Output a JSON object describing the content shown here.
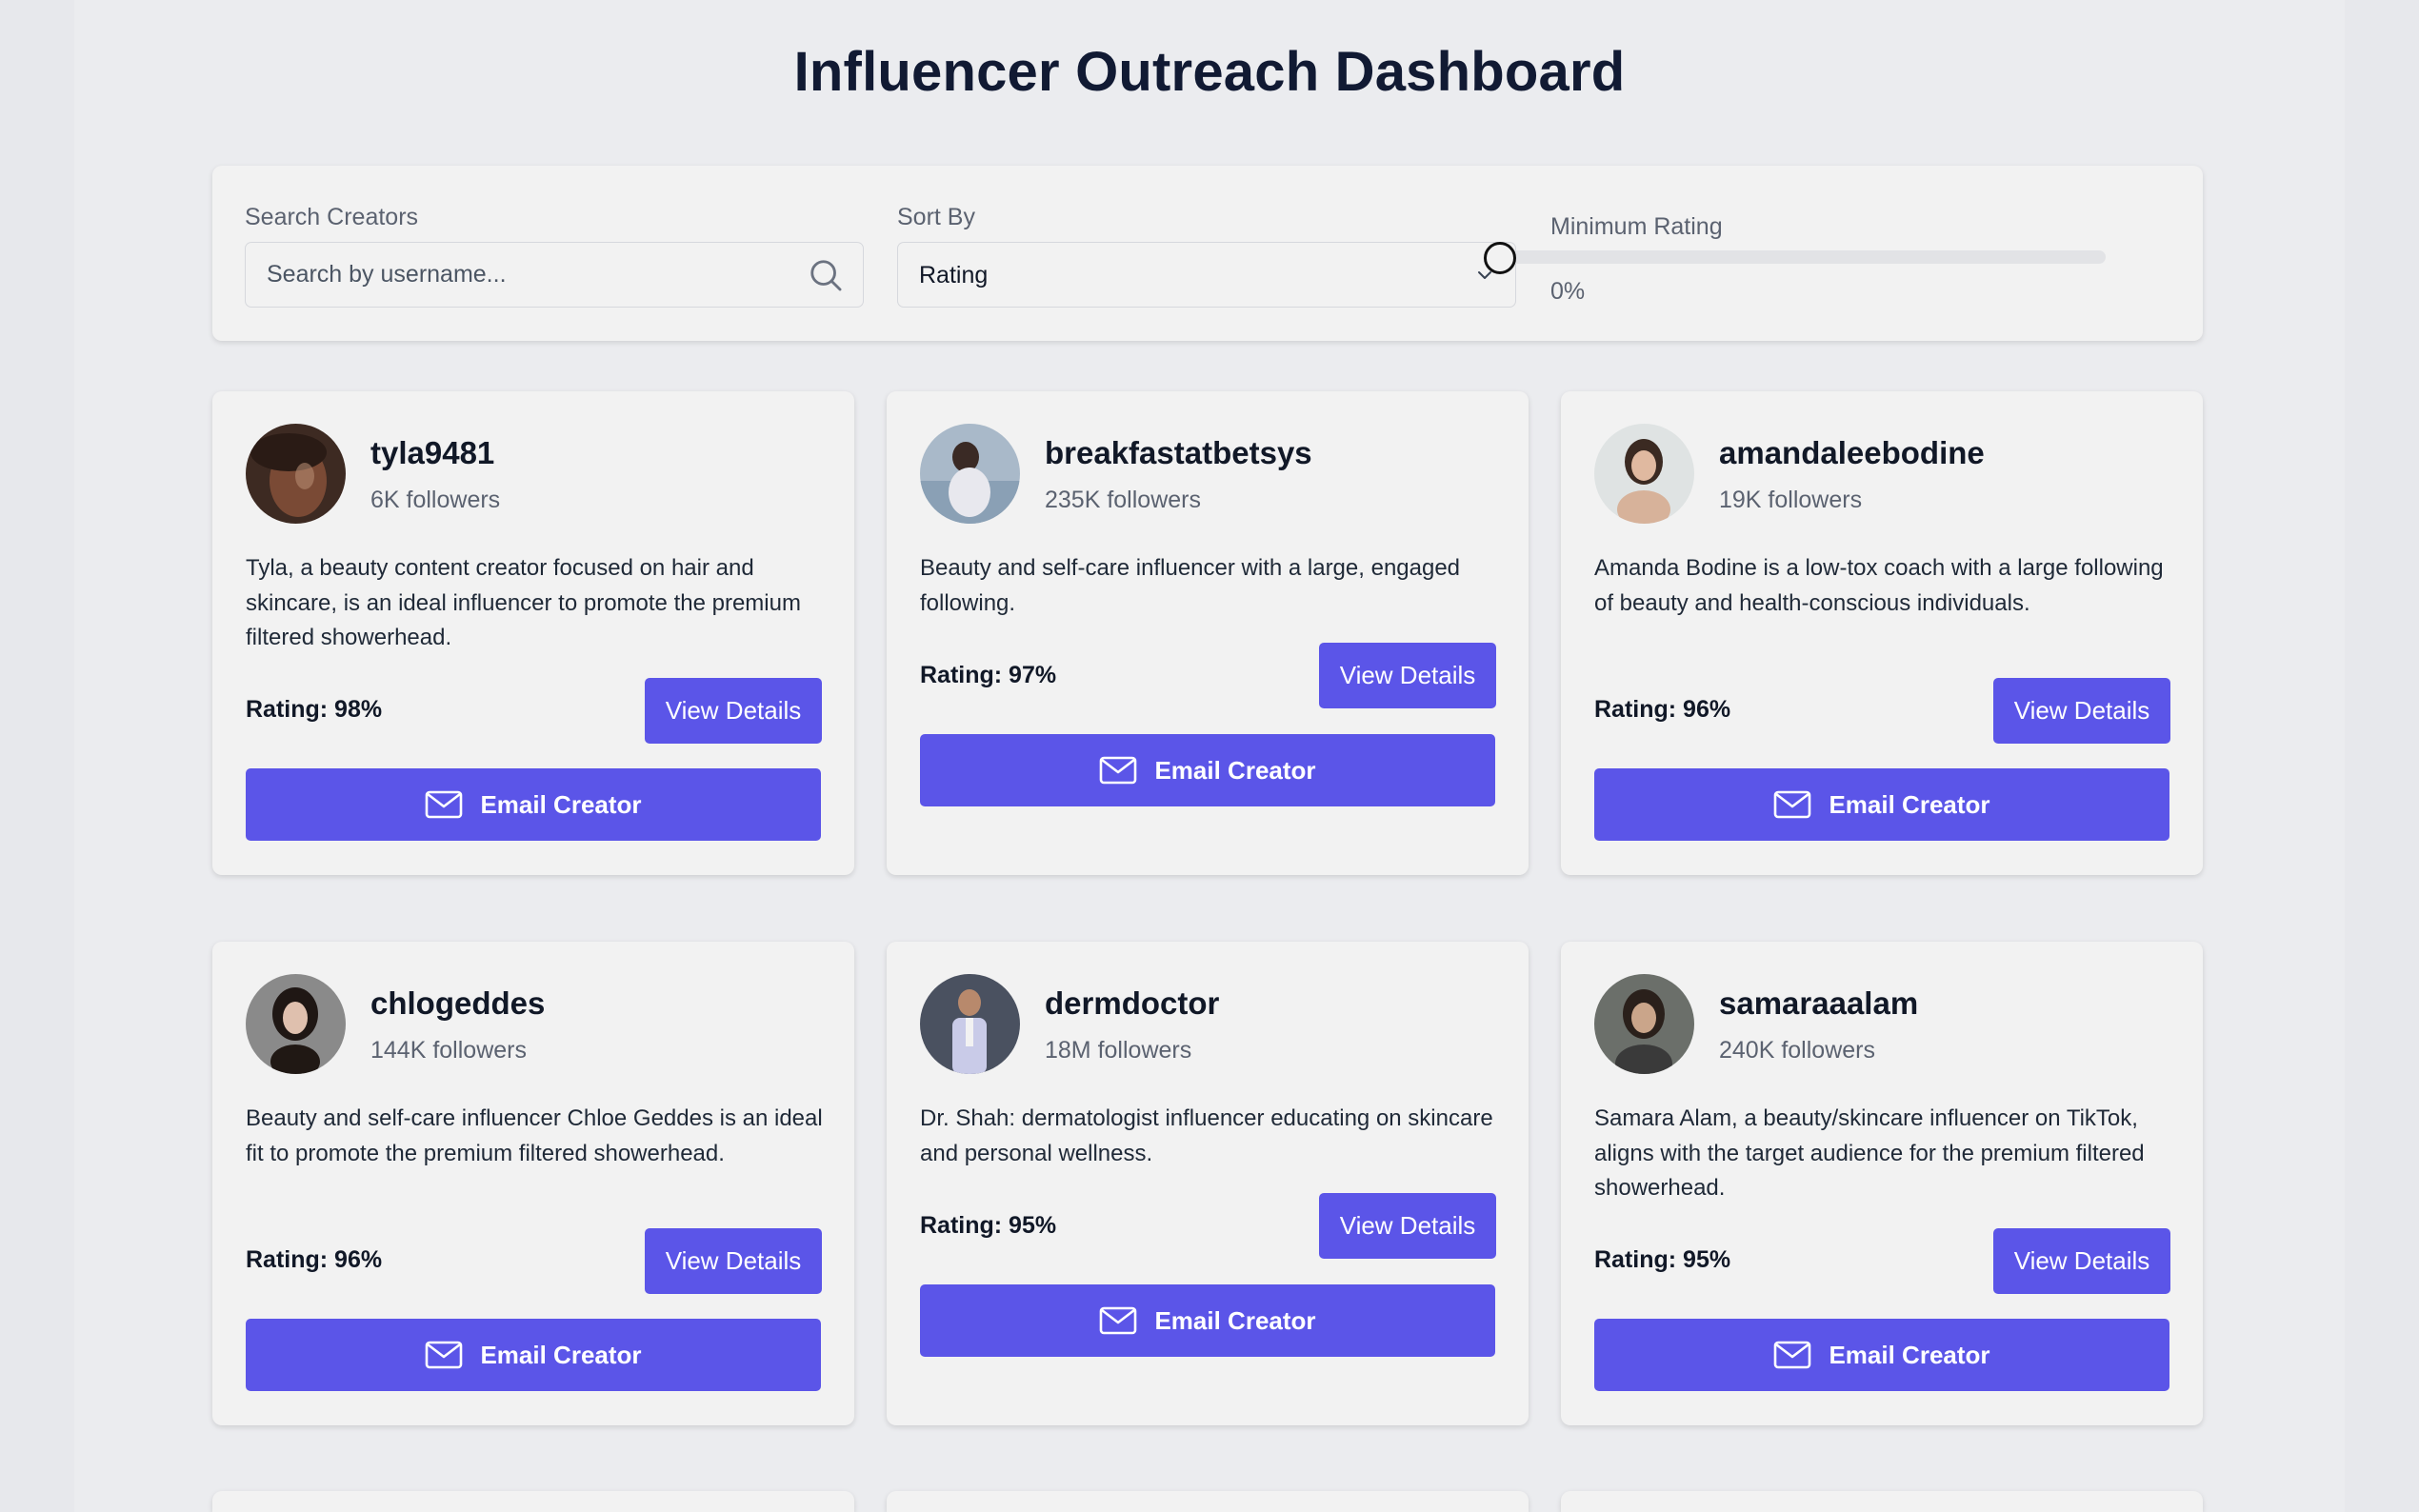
{
  "header": {
    "title": "Influencer Outreach Dashboard"
  },
  "filters": {
    "search_label": "Search Creators",
    "search_placeholder": "Search by username...",
    "sort_label": "Sort By",
    "sort_value": "Rating",
    "rating_label": "Minimum Rating",
    "rating_value": "0%",
    "rating_fraction": 0
  },
  "card_actions": {
    "view_label": "View Details",
    "email_label": "Email Creator"
  },
  "colors": {
    "accent": "#5b55e8",
    "page_bg": "#ebecef",
    "card_bg": "#f2f2f2"
  },
  "creators": [
    {
      "username": "tyla9481",
      "followers": "6K followers",
      "description": "Tyla, a beauty content creator focused on hair and skincare, is an ideal influencer to promote the premium filtered showerhead.",
      "rating": "Rating: 98%"
    },
    {
      "username": "breakfastatbetsys",
      "followers": "235K followers",
      "description": "Beauty and self-care influencer with a large, engaged following.",
      "rating": "Rating: 97%"
    },
    {
      "username": "amandaleebodine",
      "followers": "19K followers",
      "description": "Amanda Bodine is a low-tox coach with a large following of beauty and health-conscious individuals.",
      "rating": "Rating: 96%"
    },
    {
      "username": "chlogeddes",
      "followers": "144K followers",
      "description": "Beauty and self-care influencer Chloe Geddes is an ideal fit to promote the premium filtered showerhead.",
      "rating": "Rating: 96%"
    },
    {
      "username": "dermdoctor",
      "followers": "18M followers",
      "description": "Dr. Shah: dermatologist influencer educating on skincare and personal wellness.",
      "rating": "Rating: 95%"
    },
    {
      "username": "samaraaalam",
      "followers": "240K followers",
      "description": "Samara Alam, a beauty/skincare influencer on TikTok, aligns with the target audience for the premium filtered showerhead.",
      "rating": "Rating: 95%"
    }
  ]
}
